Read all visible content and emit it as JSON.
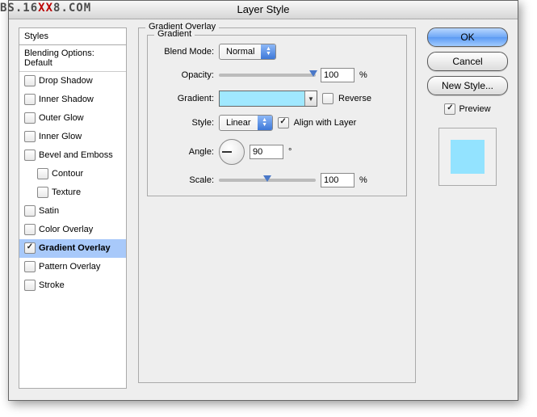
{
  "watermark": {
    "pre": "BS.16",
    "xx": "XX",
    "post": "8.COM"
  },
  "window_title": "Layer Style",
  "sidebar": {
    "header": "Styles",
    "blending": "Blending Options: Default",
    "items": [
      {
        "label": "Drop Shadow",
        "checked": false
      },
      {
        "label": "Inner Shadow",
        "checked": false
      },
      {
        "label": "Outer Glow",
        "checked": false
      },
      {
        "label": "Inner Glow",
        "checked": false
      },
      {
        "label": "Bevel and Emboss",
        "checked": false
      },
      {
        "label": "Contour",
        "checked": false,
        "sub": true
      },
      {
        "label": "Texture",
        "checked": false,
        "sub": true
      },
      {
        "label": "Satin",
        "checked": false
      },
      {
        "label": "Color Overlay",
        "checked": false
      },
      {
        "label": "Gradient Overlay",
        "checked": true,
        "selected": true
      },
      {
        "label": "Pattern Overlay",
        "checked": false
      },
      {
        "label": "Stroke",
        "checked": false
      }
    ]
  },
  "panel": {
    "title": "Gradient Overlay",
    "group": "Gradient",
    "blend_mode_label": "Blend Mode:",
    "blend_mode_value": "Normal",
    "opacity_label": "Opacity:",
    "opacity_value": "100",
    "pct": "%",
    "gradient_label": "Gradient:",
    "reverse_label": "Reverse",
    "style_label": "Style:",
    "style_value": "Linear",
    "align_label": "Align with Layer",
    "angle_label": "Angle:",
    "angle_value": "90",
    "deg": "°",
    "scale_label": "Scale:",
    "scale_value": "100"
  },
  "buttons": {
    "ok": "OK",
    "cancel": "Cancel",
    "new_style": "New Style...",
    "preview": "Preview"
  }
}
